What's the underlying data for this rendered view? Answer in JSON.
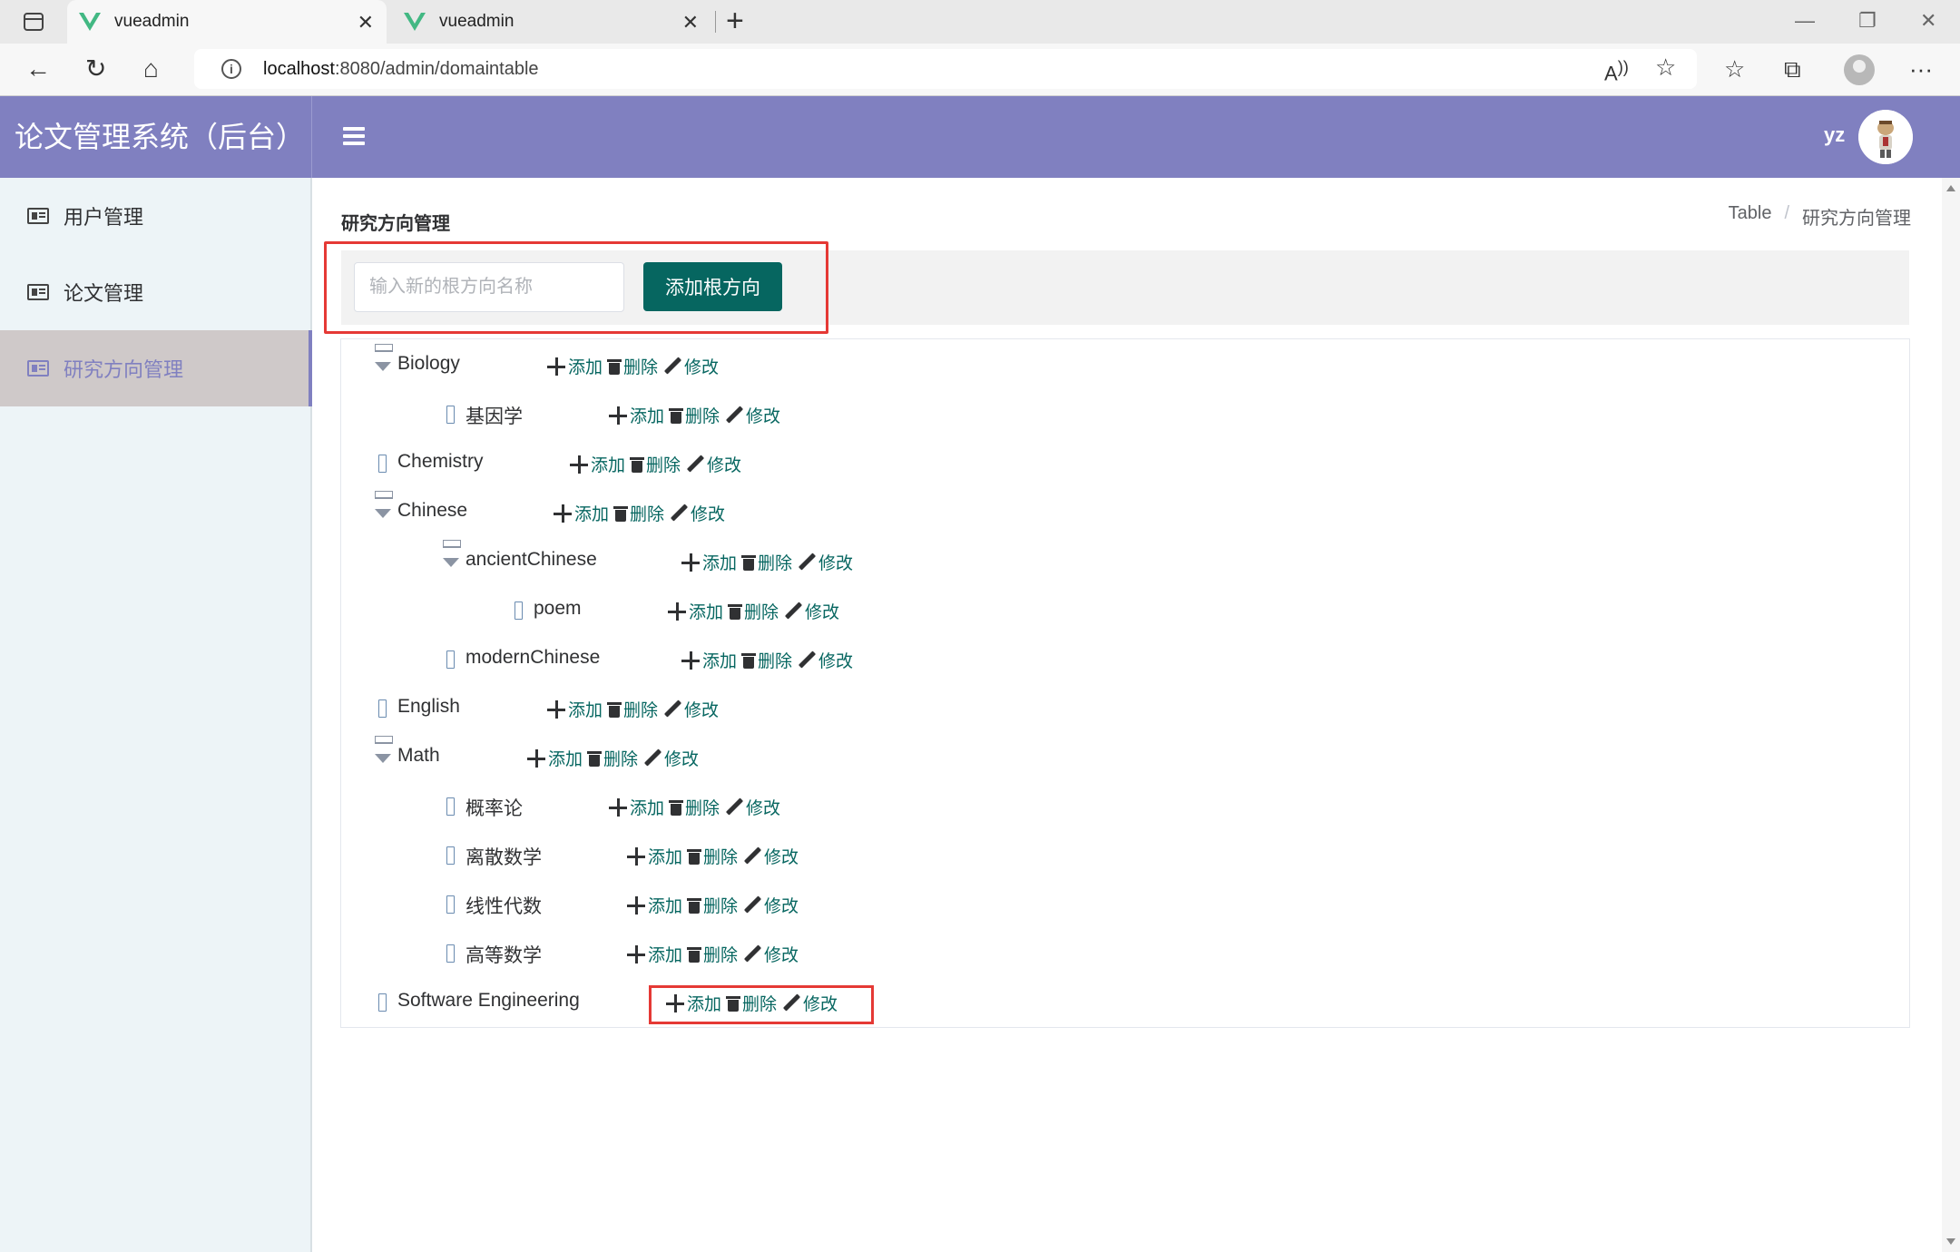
{
  "browser": {
    "tabs": [
      {
        "title": "vueadmin",
        "active": true
      },
      {
        "title": "vueadmin",
        "active": false
      }
    ],
    "url_host": "localhost",
    "url_rest": ":8080/admin/domaintable"
  },
  "app": {
    "title": "论文管理系统（后台）",
    "user": "yz",
    "accent_color": "#8080c0",
    "primary_button_color": "#066660"
  },
  "sidebar": {
    "items": [
      {
        "label": "用户管理",
        "icon": "id-card-icon",
        "active": false
      },
      {
        "label": "论文管理",
        "icon": "id-card-icon",
        "active": false
      },
      {
        "label": "研究方向管理",
        "icon": "id-card-icon",
        "active": true
      }
    ]
  },
  "page": {
    "title": "研究方向管理",
    "breadcrumb": [
      "Table",
      "研究方向管理"
    ],
    "input_placeholder": "输入新的根方向名称",
    "add_root_label": "添加根方向"
  },
  "actions": {
    "add": "添加",
    "delete": "删除",
    "edit": "修改"
  },
  "tree": [
    {
      "label": "Biology",
      "level": 0,
      "expanded": true
    },
    {
      "label": "基因学",
      "level": 1,
      "expanded": false
    },
    {
      "label": "Chemistry",
      "level": 0,
      "expanded": false
    },
    {
      "label": "Chinese",
      "level": 0,
      "expanded": true
    },
    {
      "label": "ancientChinese",
      "level": 1,
      "expanded": true
    },
    {
      "label": "poem",
      "level": 2,
      "expanded": false
    },
    {
      "label": "modernChinese",
      "level": 1,
      "expanded": false
    },
    {
      "label": "English",
      "level": 0,
      "expanded": false
    },
    {
      "label": "Math",
      "level": 0,
      "expanded": true
    },
    {
      "label": "概率论",
      "level": 1,
      "expanded": false
    },
    {
      "label": "离散数学",
      "level": 1,
      "expanded": false
    },
    {
      "label": "线性代数",
      "level": 1,
      "expanded": false
    },
    {
      "label": "高等数学",
      "level": 1,
      "expanded": false
    },
    {
      "label": "Software Engineering",
      "level": 0,
      "expanded": false
    }
  ]
}
